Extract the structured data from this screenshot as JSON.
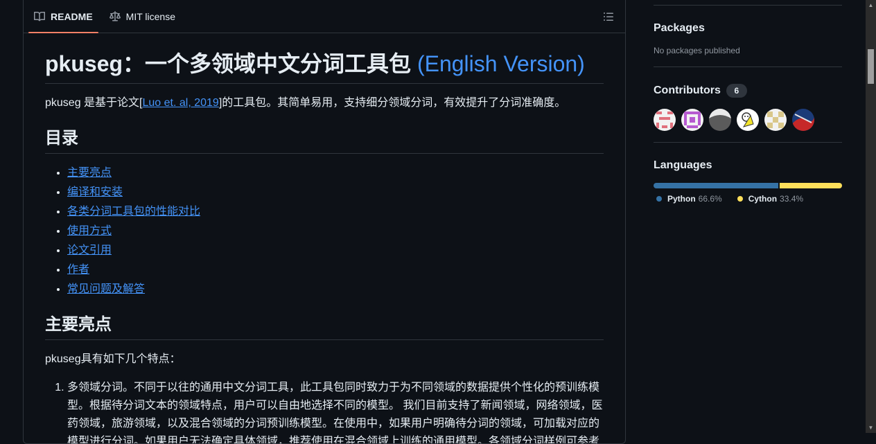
{
  "tabs": {
    "readme": "README",
    "license": "MIT license"
  },
  "readme": {
    "title_prefix": "pkuseg：一个多领域中文分词工具包 ",
    "title_link": "(English Version)",
    "intro_before": "pkuseg 是基于论文[",
    "intro_link": "Luo et. al, 2019",
    "intro_after": "]的工具包。其简单易用，支持细分领域分词，有效提升了分词准确度。",
    "toc_heading": "目录",
    "toc": [
      "主要亮点",
      "编译和安装",
      "各类分词工具包的性能对比",
      "使用方式",
      "论文引用",
      "作者",
      "常见问题及解答"
    ],
    "highlights_heading": "主要亮点",
    "highlights_intro": "pkuseg具有如下几个特点：",
    "feature_1": "多领域分词。不同于以往的通用中文分词工具，此工具包同时致力于为不同领域的数据提供个性化的预训练模型。根据待分词文本的领域特点，用户可以自由地选择不同的模型。 我们目前支持了新闻领域，网络领域，医药领域，旅游领域，以及混合领域的分词预训练模型。在使用中，如果用户明确待分词的领域，可加载对应的模型进行分词。如果用户无法确定具体领域，推荐使用在混合领域上训练的通用模型。各领域分词样例可参考"
  },
  "sidebar": {
    "packages_title": "Packages",
    "packages_empty": "No packages published",
    "contributors_title": "Contributors",
    "contributors_count": "6",
    "languages_title": "Languages",
    "languages": [
      {
        "name": "Python",
        "percent": "66.6%",
        "value": 66.6,
        "color": "#3572A5"
      },
      {
        "name": "Cython",
        "percent": "33.4%",
        "value": 33.4,
        "color": "#fedf5b"
      }
    ]
  }
}
